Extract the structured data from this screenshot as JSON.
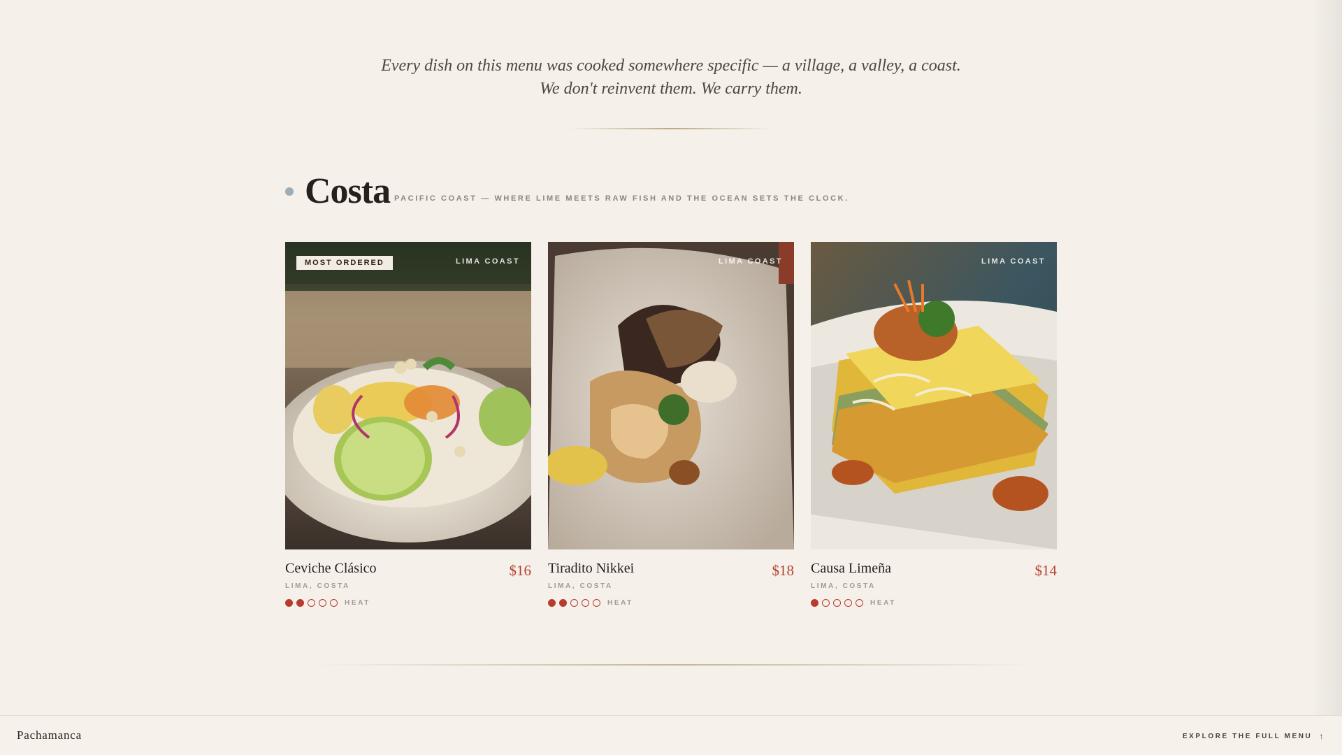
{
  "intro": {
    "line1": "Every dish on this menu was cooked somewhere specific — a village, a valley, a coast.",
    "line2": "We don't reinvent them. We carry them."
  },
  "section": {
    "title": "Costa",
    "subtitle": "PACIFIC COAST — WHERE LIME MEETS RAW FISH AND THE OCEAN SETS THE CLOCK."
  },
  "dishes": [
    {
      "name": "Ceviche Clásico",
      "price": "$16",
      "region": "LIMA, COSTA",
      "origin_tag": "LIMA COAST",
      "badge": "MOST ORDERED",
      "heat_level": 2,
      "heat_max": 5,
      "heat_label": "HEAT"
    },
    {
      "name": "Tiradito Nikkei",
      "price": "$18",
      "region": "LIMA, COSTA",
      "origin_tag": "LIMA COAST",
      "badge": "",
      "heat_level": 2,
      "heat_max": 5,
      "heat_label": "HEAT"
    },
    {
      "name": "Causa Limeña",
      "price": "$14",
      "region": "LIMA, COSTA",
      "origin_tag": "LIMA COAST",
      "badge": "",
      "heat_level": 1,
      "heat_max": 5,
      "heat_label": "HEAT"
    }
  ],
  "footer": {
    "brand": "Pachamanca",
    "explore_label": "EXPLORE THE FULL MENU",
    "explore_icon": "arrow-up-icon"
  },
  "colors": {
    "background": "#f5f0ea",
    "accent_red": "#b73c2d",
    "price_red": "#b5402e",
    "section_dot": "#9eacb5"
  }
}
